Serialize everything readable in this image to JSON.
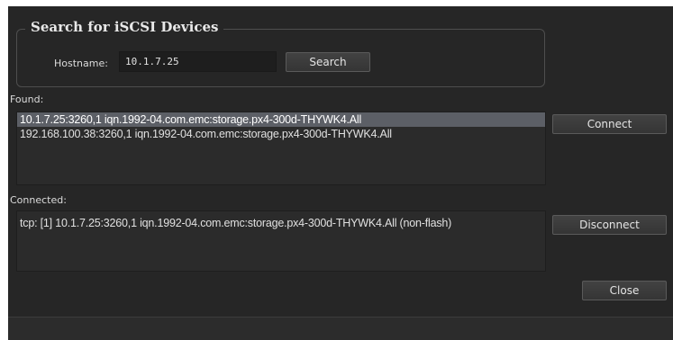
{
  "search_group": {
    "title": "Search for iSCSI Devices",
    "hostname_label": "Hostname:",
    "hostname_value": "10.1.7.25",
    "search_button": "Search"
  },
  "found": {
    "label": "Found:",
    "items": [
      "10.1.7.25:3260,1 iqn.1992-04.com.emc:storage.px4-300d-THYWK4.All",
      "192.168.100.38:3260,1 iqn.1992-04.com.emc:storage.px4-300d-THYWK4.All"
    ],
    "selected_index": 0,
    "connect_button": "Connect"
  },
  "connected": {
    "label": "Connected:",
    "items": [
      "tcp: [1] 10.1.7.25:3260,1 iqn.1992-04.com.emc:storage.px4-300d-THYWK4.All (non-flash)"
    ],
    "disconnect_button": "Disconnect"
  },
  "close_button": "Close",
  "colors": {
    "background": "#262626",
    "selection": "#5c5f66",
    "button": "#3c3c3c"
  }
}
